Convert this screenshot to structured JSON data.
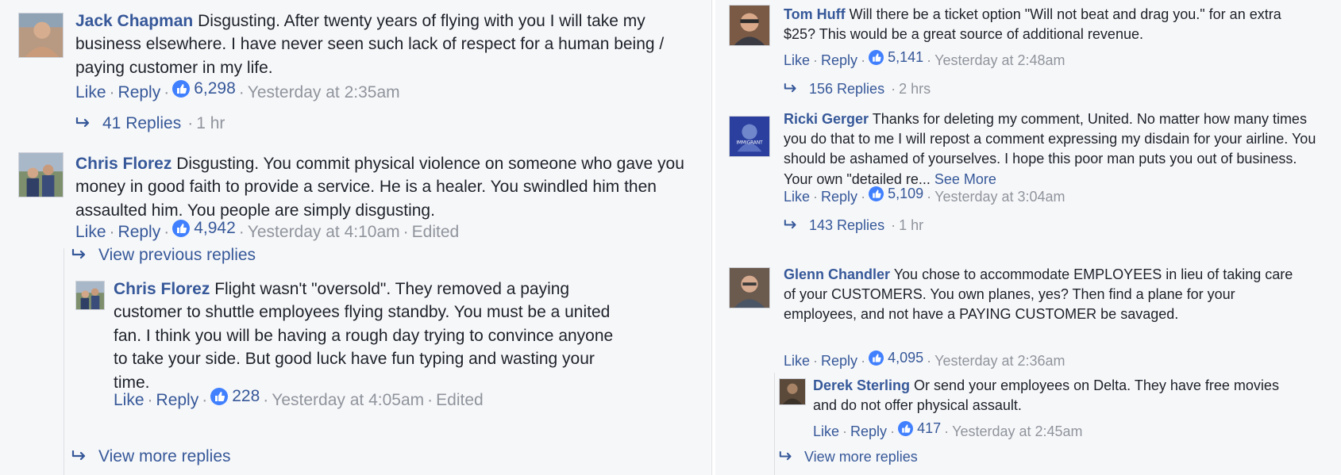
{
  "left": {
    "c1": {
      "author": "Jack Chapman",
      "text": " Disgusting. After twenty years of flying with you I will take my business elsewhere. I have never seen such lack of respect for a human being / paying customer in my life.",
      "like": "Like",
      "reply": "Reply",
      "likes": "6,298",
      "time": "Yesterday at 2:35am",
      "replies": "41 Replies",
      "replies_time": "1 hr"
    },
    "c2": {
      "author": "Chris Florez",
      "text": " Disgusting. You commit physical violence on someone who gave you money in good faith to provide a service. He is a healer. You swindled him then assaulted him. You people are simply disgusting.",
      "like": "Like",
      "reply": "Reply",
      "likes": "4,942",
      "time": "Yesterday at 4:10am",
      "edited": "Edited",
      "view_previous": "View previous replies"
    },
    "r1": {
      "author": "Chris Florez",
      "text": " Flight wasn't \"oversold\". They removed a paying customer to shuttle employees flying standby. You must be a united fan. I think you will be having a rough day trying to convince anyone to take your side. But good luck have fun typing and wasting your time.",
      "like": "Like",
      "reply": "Reply",
      "likes": "228",
      "time": "Yesterday at 4:05am",
      "edited": "Edited",
      "view_more": "View more replies"
    }
  },
  "right": {
    "c1": {
      "author": "Tom Huff",
      "text": " Will there be a ticket option \"Will not beat and drag you.\" for an extra $25? This would be a great source of additional revenue.",
      "like": "Like",
      "reply": "Reply",
      "likes": "5,141",
      "time": "Yesterday at 2:48am",
      "replies": "156 Replies",
      "replies_time": "2 hrs"
    },
    "c2": {
      "author": "Ricki Gerger",
      "text": " Thanks for deleting my comment, United. No matter how many times you do that to me I will repost a comment expressing my disdain for your airline. You should be ashamed of yourselves. I hope this poor man puts you out of business. Your own \"detailed re...",
      "see_more": "See More",
      "like": "Like",
      "reply": "Reply",
      "likes": "5,109",
      "time": "Yesterday at 3:04am",
      "replies": "143 Replies",
      "replies_time": "1 hr",
      "avatar_text": "IMMIGRANT"
    },
    "c3": {
      "author": "Glenn Chandler",
      "text": " You chose to accommodate EMPLOYEES in lieu of taking care of your CUSTOMERS. You own planes, yes? Then find a plane for your employees, and not have a PAYING CUSTOMER be savaged.",
      "like": "Like",
      "reply": "Reply",
      "likes": "4,095",
      "time": "Yesterday at 2:36am"
    },
    "r1": {
      "author": "Derek Sterling",
      "text": " Or send your employees on Delta. They have free movies and do not offer physical assault.",
      "like": "Like",
      "reply": "Reply",
      "likes": "417",
      "time": "Yesterday at 2:45am",
      "view_more": "View more replies"
    }
  },
  "colors": {
    "link": "#365899",
    "meta": "#90949c",
    "like_badge": "#4080ff",
    "background": "#f6f7f9"
  },
  "icons": [
    "reply-arrow-icon",
    "like-thumb-icon"
  ]
}
